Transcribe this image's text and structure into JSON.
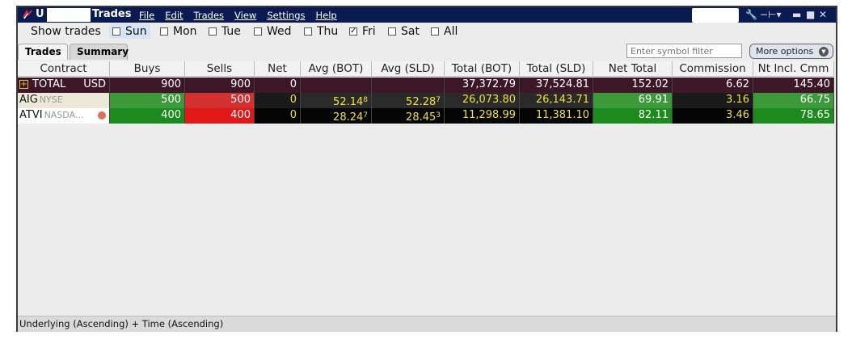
{
  "titlebar": {
    "user_initial": "U",
    "app_name": "Trades",
    "menu": [
      "File",
      "Edit",
      "Trades",
      "View",
      "Settings",
      "Help"
    ]
  },
  "show_trades": {
    "label": "Show trades",
    "days": [
      {
        "label": "Sun",
        "checked": false
      },
      {
        "label": "Mon",
        "checked": false
      },
      {
        "label": "Tue",
        "checked": false
      },
      {
        "label": "Wed",
        "checked": false
      },
      {
        "label": "Thu",
        "checked": false
      },
      {
        "label": "Fri",
        "checked": true
      },
      {
        "label": "Sat",
        "checked": false
      },
      {
        "label": "All",
        "checked": false
      }
    ]
  },
  "tabs": {
    "trades": "Trades",
    "summary": "Summary"
  },
  "filter": {
    "placeholder": "Enter symbol filter"
  },
  "more_options": "More options",
  "table": {
    "headers": [
      "Contract",
      "Buys",
      "Sells",
      "Net",
      "Avg (BOT)",
      "Avg (SLD)",
      "Total (BOT)",
      "Total (SLD)",
      "Net Total",
      "Commission",
      "Nt Incl. Cmm"
    ],
    "total": {
      "label": "TOTAL",
      "currency": "USD",
      "buys": "900",
      "sells": "900",
      "net": "0",
      "total_bot": "37,372.79",
      "total_sld": "37,524.81",
      "net_total": "152.02",
      "commission": "6.62",
      "nt_incl": "145.40"
    },
    "rows": [
      {
        "symbol": "AIG",
        "exchange": "NYSE",
        "buys": "500",
        "sells": "500",
        "net": "0",
        "avg_bot": "52.14",
        "avg_bot_sup": "8",
        "avg_sld": "52.28",
        "avg_sld_sup": "7",
        "total_bot": "26,073.80",
        "total_sld": "26,143.71",
        "net_total": "69.91",
        "commission": "3.16",
        "nt_incl": "66.75"
      },
      {
        "symbol": "ATVI",
        "exchange": "NASDA...",
        "buys": "400",
        "sells": "400",
        "net": "0",
        "avg_bot": "28.24",
        "avg_bot_sup": "7",
        "avg_sld": "28.45",
        "avg_sld_sup": "3",
        "total_bot": "11,298.99",
        "total_sld": "11,381.10",
        "net_total": "82.11",
        "commission": "3.46",
        "nt_incl": "78.65"
      }
    ]
  },
  "status": "Underlying (Ascending)  +  Time (Ascending)",
  "colors": {
    "title_bar": "#0a1a52",
    "buy_green": "#3d9a3a",
    "sell_red": "#d43030",
    "total_row": "#3d1628",
    "value_yellow": "#f0e040"
  }
}
